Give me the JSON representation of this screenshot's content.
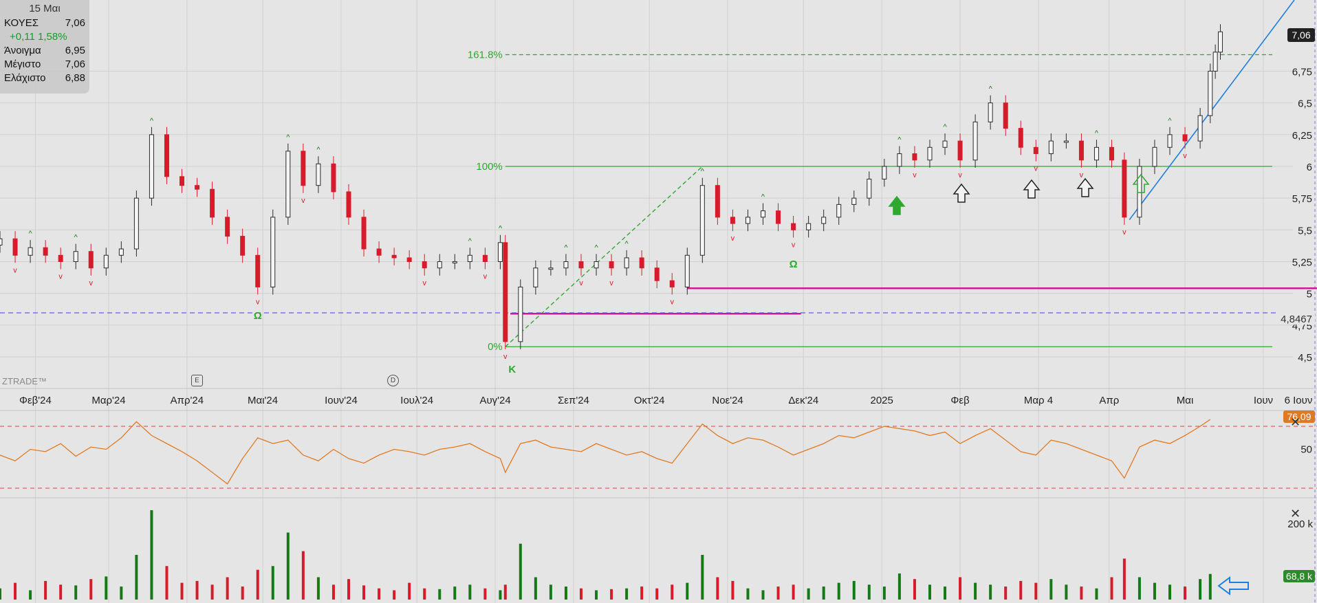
{
  "info_panel": {
    "date": "15 Μαι",
    "symbol": "ΚΟΥΕΣ",
    "price": "7,06",
    "change": "+0,11 1,58%",
    "open_label": "Άνοιγμα",
    "open": "6,95",
    "high_label": "Μέγιστο",
    "high": "7,06",
    "low_label": "Ελάχιστο",
    "low": "6,88"
  },
  "watermark": "ZTRADE™",
  "event_markers": {
    "earnings": "E",
    "dividend": "D"
  },
  "price_axis": {
    "ticks": [
      "6,75",
      "6,5",
      "6,25",
      "6",
      "5,75",
      "5,5",
      "5,25",
      "5",
      "4,75",
      "4,5"
    ],
    "last_price_label": "7,06",
    "dashed_level_label": "4,8467"
  },
  "fib_labels": [
    "161.8%",
    "100%",
    "0%"
  ],
  "time_axis": [
    "Φεβ'24",
    "Μαρ'24",
    "Απρ'24",
    "Μαι'24",
    "Ιουν'24",
    "Ιουλ'24",
    "Αυγ'24",
    "Σεπ'24",
    "Οκτ'24",
    "Νοε'24",
    "Δεκ'24",
    "2025",
    "Φεβ",
    "Μαρ 4",
    "Απρ",
    "Μαι",
    "Ιουν",
    "6 Ιουν"
  ],
  "pattern_labels": {
    "omega": "Ω",
    "kappa": "Κ"
  },
  "rsi": {
    "value_label": "76,09",
    "mid_label": "50",
    "close": "✕"
  },
  "volume": {
    "scale_label": "200 k",
    "value_label": "68,8 k",
    "close": "✕"
  },
  "colors": {
    "up": "#157a15",
    "down": "#d81b2a",
    "fib": "#2fa82f",
    "magenta": "#d0179c",
    "trend": "#1e7fe0",
    "rsi": "#e07a22",
    "rsi_band": "#e04040",
    "support": "#5b5bf0"
  },
  "chart_data": [
    {
      "type": "candlestick",
      "title": "",
      "ylim": [
        4.4,
        7.1
      ],
      "x_range": [
        "2024-01-18",
        "2025-06-10"
      ],
      "note_levels": {
        "fib_0": 4.58,
        "fib_100": 6.0,
        "fib_161_8": 6.88,
        "support_dashed": 4.8467,
        "magenta_low": 4.84,
        "magenta_high": 5.04
      },
      "trendline": {
        "from": [
          "2025-04-09",
          5.58
        ],
        "to": [
          "2025-06-08",
          7.3
        ]
      },
      "fib_swing": {
        "from": [
          "2024-08-05",
          4.58
        ],
        "to": [
          "2024-10-22",
          6.0
        ]
      },
      "close_series": [
        [
          "2024-01-18",
          5.43
        ],
        [
          "2024-01-24",
          5.3
        ],
        [
          "2024-01-30",
          5.36
        ],
        [
          "2024-02-05",
          5.3
        ],
        [
          "2024-02-11",
          5.25
        ],
        [
          "2024-02-17",
          5.33
        ],
        [
          "2024-02-23",
          5.2
        ],
        [
          "2024-02-29",
          5.3
        ],
        [
          "2024-03-06",
          5.35
        ],
        [
          "2024-03-12",
          5.75
        ],
        [
          "2024-03-18",
          6.25
        ],
        [
          "2024-03-24",
          5.92
        ],
        [
          "2024-03-30",
          5.85
        ],
        [
          "2024-04-05",
          5.82
        ],
        [
          "2024-04-11",
          5.6
        ],
        [
          "2024-04-17",
          5.45
        ],
        [
          "2024-04-23",
          5.3
        ],
        [
          "2024-04-29",
          5.05
        ],
        [
          "2024-05-05",
          5.6
        ],
        [
          "2024-05-11",
          6.12
        ],
        [
          "2024-05-17",
          5.85
        ],
        [
          "2024-05-23",
          6.02
        ],
        [
          "2024-05-29",
          5.8
        ],
        [
          "2024-06-04",
          5.6
        ],
        [
          "2024-06-10",
          5.35
        ],
        [
          "2024-06-16",
          5.3
        ],
        [
          "2024-06-22",
          5.28
        ],
        [
          "2024-06-28",
          5.25
        ],
        [
          "2024-07-04",
          5.2
        ],
        [
          "2024-07-10",
          5.25
        ],
        [
          "2024-07-16",
          5.25
        ],
        [
          "2024-07-22",
          5.3
        ],
        [
          "2024-07-28",
          5.25
        ],
        [
          "2024-08-03",
          5.4
        ],
        [
          "2024-08-05",
          4.62
        ],
        [
          "2024-08-11",
          5.05
        ],
        [
          "2024-08-17",
          5.2
        ],
        [
          "2024-08-23",
          5.2
        ],
        [
          "2024-08-29",
          5.25
        ],
        [
          "2024-09-04",
          5.2
        ],
        [
          "2024-09-10",
          5.25
        ],
        [
          "2024-09-16",
          5.2
        ],
        [
          "2024-09-22",
          5.28
        ],
        [
          "2024-09-28",
          5.2
        ],
        [
          "2024-10-04",
          5.1
        ],
        [
          "2024-10-10",
          5.05
        ],
        [
          "2024-10-16",
          5.3
        ],
        [
          "2024-10-22",
          5.85
        ],
        [
          "2024-10-28",
          5.6
        ],
        [
          "2024-11-03",
          5.55
        ],
        [
          "2024-11-09",
          5.6
        ],
        [
          "2024-11-15",
          5.65
        ],
        [
          "2024-11-21",
          5.55
        ],
        [
          "2024-11-27",
          5.5
        ],
        [
          "2024-12-03",
          5.55
        ],
        [
          "2024-12-09",
          5.6
        ],
        [
          "2024-12-15",
          5.7
        ],
        [
          "2024-12-21",
          5.75
        ],
        [
          "2024-12-27",
          5.9
        ],
        [
          "2025-01-02",
          6.0
        ],
        [
          "2025-01-08",
          6.1
        ],
        [
          "2025-01-14",
          6.05
        ],
        [
          "2025-01-20",
          6.15
        ],
        [
          "2025-01-26",
          6.2
        ],
        [
          "2025-02-01",
          6.05
        ],
        [
          "2025-02-07",
          6.35
        ],
        [
          "2025-02-13",
          6.5
        ],
        [
          "2025-02-19",
          6.3
        ],
        [
          "2025-02-25",
          6.15
        ],
        [
          "2025-03-03",
          6.1
        ],
        [
          "2025-03-09",
          6.2
        ],
        [
          "2025-03-15",
          6.2
        ],
        [
          "2025-03-21",
          6.05
        ],
        [
          "2025-03-27",
          6.15
        ],
        [
          "2025-04-02",
          6.05
        ],
        [
          "2025-04-07",
          5.6
        ],
        [
          "2025-04-13",
          6.0
        ],
        [
          "2025-04-19",
          6.15
        ],
        [
          "2025-04-25",
          6.25
        ],
        [
          "2025-05-01",
          6.2
        ],
        [
          "2025-05-07",
          6.4
        ],
        [
          "2025-05-11",
          6.75
        ],
        [
          "2025-05-13",
          6.9
        ],
        [
          "2025-05-15",
          7.06
        ]
      ]
    },
    {
      "type": "line",
      "title": "",
      "ylim": [
        20,
        85
      ],
      "bands": [
        30,
        70
      ],
      "last_value": 76.09,
      "series": [
        {
          "values": [
            45,
            40,
            50,
            48,
            55,
            44,
            52,
            50,
            60,
            74,
            62,
            55,
            48,
            40,
            30,
            20,
            42,
            60,
            55,
            58,
            45,
            40,
            50,
            42,
            38,
            45,
            50,
            48,
            45,
            50,
            52,
            55,
            48,
            42,
            30,
            55,
            58,
            52,
            50,
            48,
            55,
            50,
            45,
            48,
            42,
            38,
            55,
            72,
            62,
            55,
            60,
            58,
            52,
            45,
            50,
            55,
            62,
            60,
            65,
            70,
            68,
            66,
            62,
            65,
            55,
            62,
            68,
            58,
            48,
            45,
            58,
            55,
            50,
            45,
            40,
            25,
            52,
            58,
            55,
            62,
            70,
            76
          ]
        }
      ]
    },
    {
      "type": "bar",
      "title": "",
      "ylim": [
        0,
        260
      ],
      "last_value_k": 68.8,
      "series": [
        {
          "values": [
            30,
            45,
            25,
            50,
            40,
            38,
            55,
            62,
            35,
            120,
            240,
            90,
            45,
            50,
            40,
            60,
            35,
            80,
            90,
            180,
            130,
            60,
            40,
            55,
            38,
            30,
            25,
            45,
            30,
            28,
            35,
            40,
            30,
            25,
            40,
            150,
            60,
            40,
            35,
            30,
            25,
            28,
            30,
            35,
            30,
            40,
            45,
            120,
            60,
            50,
            30,
            25,
            35,
            40,
            30,
            35,
            45,
            50,
            40,
            35,
            70,
            55,
            40,
            35,
            60,
            45,
            40,
            35,
            50,
            45,
            55,
            40,
            35,
            30,
            60,
            110,
            60,
            45,
            40,
            35,
            55,
            68.8
          ]
        }
      ]
    }
  ]
}
